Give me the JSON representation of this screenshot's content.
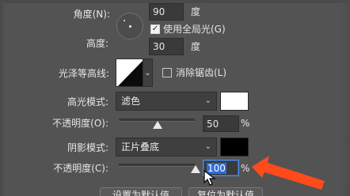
{
  "labels": {
    "angle": "角度(N):",
    "angle_unit": "度",
    "global_light": "使用全局光(G)",
    "altitude": "高度:",
    "altitude_unit": "度",
    "gloss_contour": "光泽等高线:",
    "anti_alias": "消除锯齿(L)",
    "highlight_mode": "高光模式:",
    "highlight_opacity": "不透明度(O):",
    "percent_1": "%",
    "shadow_mode": "阴影模式:",
    "shadow_opacity": "不透明度(C):",
    "percent_2": "%"
  },
  "values": {
    "angle": "90",
    "altitude": "30",
    "highlight_opacity": "50",
    "shadow_opacity": "100",
    "highlight_mode": "滤色",
    "shadow_mode": "正片叠底"
  },
  "checkboxes": {
    "global_light_checked": true,
    "anti_alias_checked": false
  },
  "sliders": {
    "highlight_opacity_percent": 50,
    "shadow_opacity_percent": 100
  },
  "footer": {
    "set_default": "设置为默认值",
    "reset_default": "复位为默认值"
  },
  "colors": {
    "highlight_color": "#ffffff",
    "shadow_color": "#000000",
    "annotation_arrow": "#ff4a1c"
  },
  "icons": {
    "dropdown": "chevron-down-icon",
    "cursor": "mouse-pointer-icon",
    "annotation": "orange-arrow-icon"
  }
}
